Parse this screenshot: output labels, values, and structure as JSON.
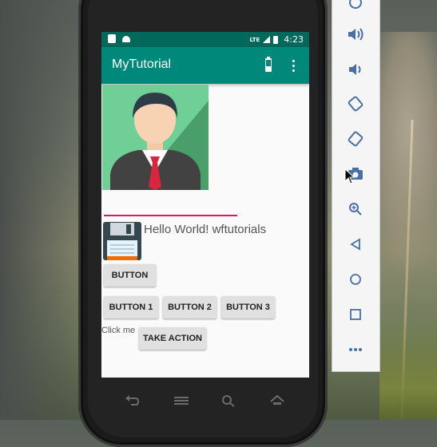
{
  "statusbar": {
    "network": "LTE",
    "time": "4:23"
  },
  "appbar": {
    "title": "MyTutorial"
  },
  "content": {
    "hello_text": "Hello World! wftutorials",
    "button_main": "BUTTON",
    "button_1": "BUTTON 1",
    "button_2": "BUTTON 2",
    "button_3": "BUTTON 3",
    "click_me": "Click me",
    "take_action": "TAKE ACTION"
  },
  "colors": {
    "statusbar": "#00695c",
    "appbar": "#00897b",
    "accent_line": "#d81b60"
  },
  "emulator_panel": {
    "buttons": [
      "power-icon",
      "volume-up-icon",
      "volume-down-icon",
      "rotate-left-icon",
      "rotate-right-icon",
      "camera-icon",
      "zoom-icon",
      "back-icon",
      "home-icon",
      "overview-icon",
      "more-icon"
    ]
  }
}
